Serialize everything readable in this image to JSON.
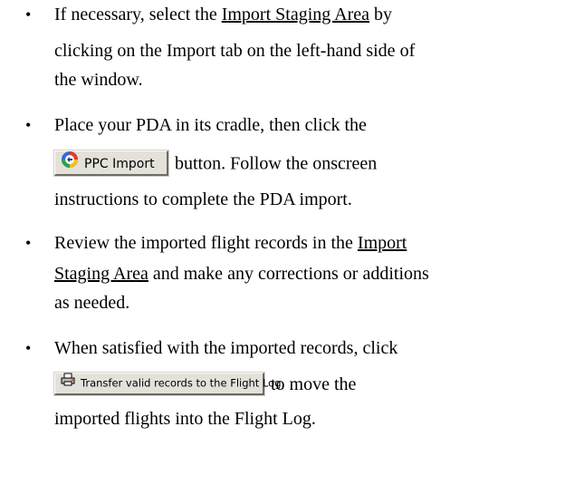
{
  "bullets": [
    {
      "lines": [
        {
          "pre": "If necessary, select the ",
          "link": "Import Staging Area",
          "post": " by"
        },
        {
          "text": "clicking on the Import tab on the left-hand side of"
        },
        {
          "text": "the window."
        }
      ]
    },
    {
      "line1": "Place your PDA in its cradle, then click the",
      "button_label": "PPC Import",
      "button_icon": "ppc-import-icon",
      "after_button": "button.  Follow the onscreen",
      "line3": "instructions to complete the PDA import."
    },
    {
      "line1_pre": "Review the imported flight records in the ",
      "link1": "Import",
      "link2": "Staging Area",
      "line2_post": " and make any corrections or additions",
      "line3": "as needed."
    },
    {
      "line1": "When satisfied with the imported records, click",
      "button_label": "Transfer valid records to the Flight Log",
      "button_icon": "printer-transfer-icon",
      "after_button": "to move the",
      "line3": "imported flights into the Flight Log."
    }
  ],
  "bullet_char": "•"
}
